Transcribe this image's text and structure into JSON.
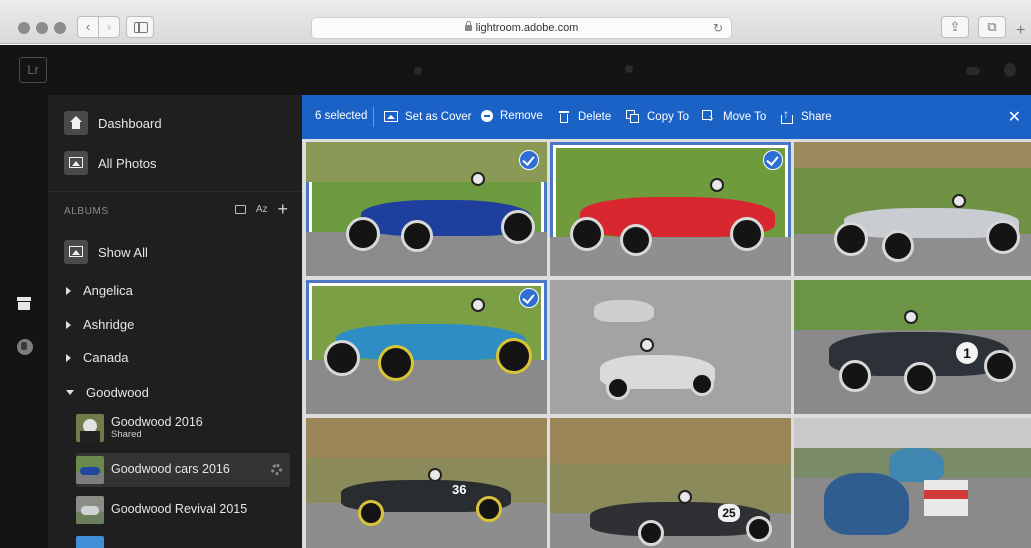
{
  "browser": {
    "url": "lightroom.adobe.com",
    "reload_icon": "↻",
    "back_icon": "‹",
    "forward_icon": "›",
    "share_icon": "⇪",
    "tabs_icon": "⧉",
    "new_tab_icon": "+"
  },
  "app": {
    "logo_text": "Lr"
  },
  "sidebar": {
    "nav": [
      {
        "label": "Dashboard",
        "icon": "home-icon"
      },
      {
        "label": "All Photos",
        "icon": "photo-icon"
      }
    ],
    "albums_header": "ALBUMS",
    "sort_label": "Az",
    "add_label": "+",
    "show_all": "Show All",
    "folders": [
      {
        "label": "Angelica",
        "expanded": false
      },
      {
        "label": "Ashridge",
        "expanded": false
      },
      {
        "label": "Canada",
        "expanded": false
      },
      {
        "label": "Goodwood",
        "expanded": true
      }
    ],
    "albums": [
      {
        "name": "Goodwood 2016",
        "sub": "Shared"
      },
      {
        "name": "Goodwood cars 2016",
        "sub": ""
      },
      {
        "name": "Goodwood Revival 2015",
        "sub": ""
      }
    ]
  },
  "selection_bar": {
    "count_label": "6 selected",
    "actions": [
      {
        "label": "Set as Cover",
        "icon": "set-cover-icon"
      },
      {
        "label": "Remove",
        "icon": "remove-icon"
      },
      {
        "label": "Delete",
        "icon": "trash-icon"
      },
      {
        "label": "Copy To",
        "icon": "copy-icon"
      },
      {
        "label": "Move To",
        "icon": "move-icon"
      },
      {
        "label": "Share",
        "icon": "share-icon"
      }
    ],
    "close_label": "✕",
    "accent_color": "#1b62c7"
  },
  "grid": {
    "photos": [
      {
        "name": "blue-race-car",
        "selected": true,
        "car_color": "#1f3f9e",
        "number": ""
      },
      {
        "name": "red-race-car",
        "selected": true,
        "car_color": "#d8272e",
        "number": ""
      },
      {
        "name": "silver-race-car",
        "selected": false,
        "car_color": "#c9ccd0",
        "number": ""
      },
      {
        "name": "light-blue-race-car",
        "selected": true,
        "car_color": "#2e8ec4",
        "number": ""
      },
      {
        "name": "white-sports-cars",
        "selected": false,
        "car_color": "#dadada",
        "number": ""
      },
      {
        "name": "dark-green-sports-car",
        "selected": false,
        "car_color": "#2c3238",
        "number": "1"
      },
      {
        "name": "black-sports-car-36",
        "selected": false,
        "car_color": "#2a2d30",
        "number": "36"
      },
      {
        "name": "black-sports-car-25",
        "selected": false,
        "car_color": "#2e3033",
        "number": "25"
      },
      {
        "name": "blue-saloon-cars",
        "selected": false,
        "car_color": "#2f5d8f",
        "number": ""
      }
    ]
  }
}
